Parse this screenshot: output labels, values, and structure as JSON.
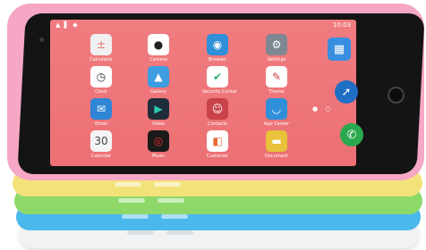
{
  "status_bar": {
    "time": "10:03",
    "icons": "▲ ▌ ◆"
  },
  "apps": [
    {
      "name": "Calculator",
      "icon": "calculator-icon",
      "glyph": "±",
      "color": "#f0f0f0",
      "fg": "#e46a6a"
    },
    {
      "name": "Camera",
      "icon": "camera-icon",
      "glyph": "●",
      "color": "#ffffff",
      "fg": "#222"
    },
    {
      "name": "Browser",
      "icon": "browser-icon",
      "glyph": "◉",
      "color": "#2f8fd8",
      "fg": "#fff"
    },
    {
      "name": "Settings",
      "icon": "settings-icon",
      "glyph": "⚙",
      "color": "#7d8790",
      "fg": "#fff"
    },
    {
      "name": "Clock",
      "icon": "clock-icon",
      "glyph": "◷",
      "color": "#ffffff",
      "fg": "#333"
    },
    {
      "name": "Gallery",
      "icon": "gallery-icon",
      "glyph": "▲",
      "color": "#3d9de0",
      "fg": "#fff"
    },
    {
      "name": "Security Center",
      "icon": "shield-icon",
      "glyph": "✔",
      "color": "#ffffff",
      "fg": "#2ab36b"
    },
    {
      "name": "Theme",
      "icon": "theme-icon",
      "glyph": "✎",
      "color": "#ffffff",
      "fg": "#d43c3c"
    },
    {
      "name": "Email",
      "icon": "email-icon",
      "glyph": "✉",
      "color": "#2e86d4",
      "fg": "#fff"
    },
    {
      "name": "Video",
      "icon": "video-icon",
      "glyph": "▶",
      "color": "#1f2d3a",
      "fg": "#2fc8b0"
    },
    {
      "name": "Contacts",
      "icon": "contacts-icon",
      "glyph": "☺",
      "color": "#c9424a",
      "fg": "#fff"
    },
    {
      "name": "App Center",
      "icon": "app-center-icon",
      "glyph": "◡",
      "color": "#2f8fd8",
      "fg": "#fff"
    },
    {
      "name": "Calendar",
      "icon": "calendar-icon",
      "glyph": "30",
      "color": "#f4f4f4",
      "fg": "#444"
    },
    {
      "name": "Music",
      "icon": "music-icon",
      "glyph": "◎",
      "color": "#1a1a1a",
      "fg": "#e33"
    },
    {
      "name": "Customer",
      "icon": "customer-icon",
      "glyph": "◧",
      "color": "#ffffff",
      "fg": "#e56b2f"
    },
    {
      "name": "Document",
      "icon": "document-icon",
      "glyph": "▬",
      "color": "#e8c23a",
      "fg": "#fff"
    }
  ],
  "dock": [
    {
      "name": "tiles",
      "icon": "tiles-icon",
      "glyph": "▦",
      "color": "#3a8ee0"
    },
    {
      "name": "compass",
      "icon": "compass-icon",
      "glyph": "➚",
      "color": "#1f6fc4"
    },
    {
      "name": "phone",
      "icon": "phone-icon",
      "glyph": "✆",
      "color": "#2aa94e"
    }
  ],
  "shell_colors": {
    "pink": "#f6a7c6",
    "yellow": "#f3e27a",
    "green": "#8ed86a",
    "blue": "#4ab8ea",
    "white": "#f1f2f3"
  }
}
